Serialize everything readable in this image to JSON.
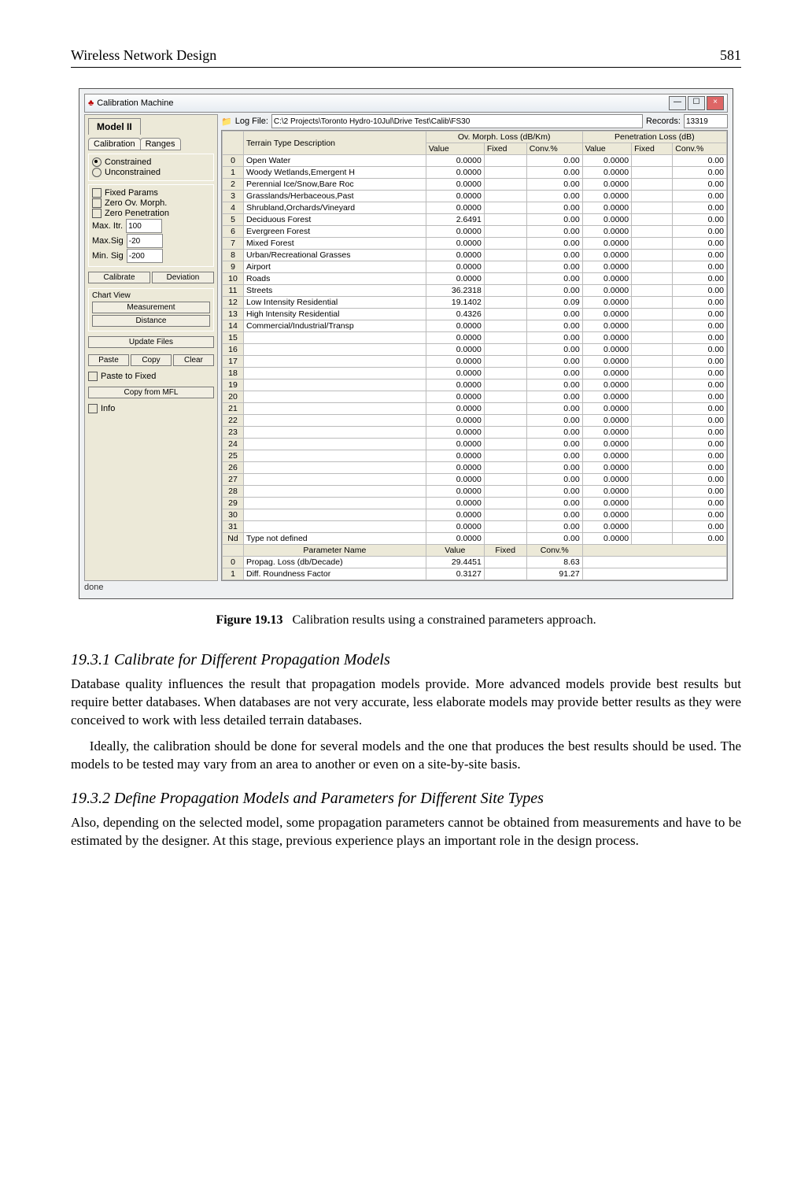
{
  "header": {
    "left": "Wireless Network Design",
    "right": "581"
  },
  "window": {
    "title": "Calibration Machine",
    "btn_min": "—",
    "btn_max": "☐",
    "btn_close": "×",
    "model_label": "Model II",
    "tabs": {
      "calibration": "Calibration",
      "ranges": "Ranges"
    },
    "radio_constrained": "Constrained",
    "radio_unconstrained": "Unconstrained",
    "chk_fixed_params": "Fixed Params",
    "chk_zero_ov": "Zero Ov. Morph.",
    "chk_zero_pen": "Zero Penetration",
    "lbl_max_itr": "Max. Itr.",
    "val_max_itr": "100",
    "lbl_max_sig": "Max.Sig",
    "val_max_sig": "-20",
    "lbl_min_sig": "Min. Sig",
    "val_min_sig": "-200",
    "btn_calibrate": "Calibrate",
    "btn_deviation": "Deviation",
    "chart_title": "Chart View",
    "btn_measurement": "Measurement",
    "btn_distance": "Distance",
    "btn_update": "Update Files",
    "btn_paste": "Paste",
    "btn_copy": "Copy",
    "btn_clear": "Clear",
    "chk_paste_fixed": "Paste to Fixed",
    "btn_copy_mfl": "Copy from MFL",
    "chk_info": "Info",
    "log_label": "Log File:",
    "log_path": "C:\\2 Projects\\Toronto Hydro-10Jul\\Drive Test\\Calib\\FS30",
    "records_label": "Records:",
    "records_val": "13319",
    "col_terrain": "Terrain Type Description",
    "grp_ov": "Ov. Morph. Loss (dB/Km)",
    "grp_pen": "Penetration Loss (dB)",
    "col_value": "Value",
    "col_fixed": "Fixed",
    "col_conv": "Conv.%",
    "param_header": "Parameter Name",
    "status": "done"
  },
  "terrain": [
    {
      "n": "0",
      "d": "Open Water",
      "ov": "0.0000",
      "oc": "0.00",
      "pv": "0.0000",
      "pc": "0.00"
    },
    {
      "n": "1",
      "d": "Woody Wetlands,Emergent H",
      "ov": "0.0000",
      "oc": "0.00",
      "pv": "0.0000",
      "pc": "0.00"
    },
    {
      "n": "2",
      "d": "Perennial Ice/Snow,Bare Roc",
      "ov": "0.0000",
      "oc": "0.00",
      "pv": "0.0000",
      "pc": "0.00"
    },
    {
      "n": "3",
      "d": "Grasslands/Herbaceous,Past",
      "ov": "0.0000",
      "oc": "0.00",
      "pv": "0.0000",
      "pc": "0.00"
    },
    {
      "n": "4",
      "d": "Shrubland,Orchards/Vineyard",
      "ov": "0.0000",
      "oc": "0.00",
      "pv": "0.0000",
      "pc": "0.00"
    },
    {
      "n": "5",
      "d": "Deciduous Forest",
      "ov": "2.6491",
      "oc": "0.00",
      "pv": "0.0000",
      "pc": "0.00"
    },
    {
      "n": "6",
      "d": "Evergreen Forest",
      "ov": "0.0000",
      "oc": "0.00",
      "pv": "0.0000",
      "pc": "0.00"
    },
    {
      "n": "7",
      "d": "Mixed Forest",
      "ov": "0.0000",
      "oc": "0.00",
      "pv": "0.0000",
      "pc": "0.00"
    },
    {
      "n": "8",
      "d": "Urban/Recreational Grasses",
      "ov": "0.0000",
      "oc": "0.00",
      "pv": "0.0000",
      "pc": "0.00"
    },
    {
      "n": "9",
      "d": "Airport",
      "ov": "0.0000",
      "oc": "0.00",
      "pv": "0.0000",
      "pc": "0.00"
    },
    {
      "n": "10",
      "d": "Roads",
      "ov": "0.0000",
      "oc": "0.00",
      "pv": "0.0000",
      "pc": "0.00"
    },
    {
      "n": "11",
      "d": "Streets",
      "ov": "36.2318",
      "oc": "0.00",
      "pv": "0.0000",
      "pc": "0.00"
    },
    {
      "n": "12",
      "d": "Low Intensity Residential",
      "ov": "19.1402",
      "oc": "0.09",
      "pv": "0.0000",
      "pc": "0.00"
    },
    {
      "n": "13",
      "d": "High Intensity Residential",
      "ov": "0.4326",
      "oc": "0.00",
      "pv": "0.0000",
      "pc": "0.00"
    },
    {
      "n": "14",
      "d": "Commercial/Industrial/Transp",
      "ov": "0.0000",
      "oc": "0.00",
      "pv": "0.0000",
      "pc": "0.00"
    },
    {
      "n": "15",
      "d": "",
      "ov": "0.0000",
      "oc": "0.00",
      "pv": "0.0000",
      "pc": "0.00"
    },
    {
      "n": "16",
      "d": "",
      "ov": "0.0000",
      "oc": "0.00",
      "pv": "0.0000",
      "pc": "0.00"
    },
    {
      "n": "17",
      "d": "",
      "ov": "0.0000",
      "oc": "0.00",
      "pv": "0.0000",
      "pc": "0.00"
    },
    {
      "n": "18",
      "d": "",
      "ov": "0.0000",
      "oc": "0.00",
      "pv": "0.0000",
      "pc": "0.00"
    },
    {
      "n": "19",
      "d": "",
      "ov": "0.0000",
      "oc": "0.00",
      "pv": "0.0000",
      "pc": "0.00"
    },
    {
      "n": "20",
      "d": "",
      "ov": "0.0000",
      "oc": "0.00",
      "pv": "0.0000",
      "pc": "0.00"
    },
    {
      "n": "21",
      "d": "",
      "ov": "0.0000",
      "oc": "0.00",
      "pv": "0.0000",
      "pc": "0.00"
    },
    {
      "n": "22",
      "d": "",
      "ov": "0.0000",
      "oc": "0.00",
      "pv": "0.0000",
      "pc": "0.00"
    },
    {
      "n": "23",
      "d": "",
      "ov": "0.0000",
      "oc": "0.00",
      "pv": "0.0000",
      "pc": "0.00"
    },
    {
      "n": "24",
      "d": "",
      "ov": "0.0000",
      "oc": "0.00",
      "pv": "0.0000",
      "pc": "0.00"
    },
    {
      "n": "25",
      "d": "",
      "ov": "0.0000",
      "oc": "0.00",
      "pv": "0.0000",
      "pc": "0.00"
    },
    {
      "n": "26",
      "d": "",
      "ov": "0.0000",
      "oc": "0.00",
      "pv": "0.0000",
      "pc": "0.00"
    },
    {
      "n": "27",
      "d": "",
      "ov": "0.0000",
      "oc": "0.00",
      "pv": "0.0000",
      "pc": "0.00"
    },
    {
      "n": "28",
      "d": "",
      "ov": "0.0000",
      "oc": "0.00",
      "pv": "0.0000",
      "pc": "0.00"
    },
    {
      "n": "29",
      "d": "",
      "ov": "0.0000",
      "oc": "0.00",
      "pv": "0.0000",
      "pc": "0.00"
    },
    {
      "n": "30",
      "d": "",
      "ov": "0.0000",
      "oc": "0.00",
      "pv": "0.0000",
      "pc": "0.00"
    },
    {
      "n": "31",
      "d": "",
      "ov": "0.0000",
      "oc": "0.00",
      "pv": "0.0000",
      "pc": "0.00"
    },
    {
      "n": "Nd",
      "d": "Type not defined",
      "ov": "0.0000",
      "oc": "0.00",
      "pv": "0.0000",
      "pc": "0.00"
    }
  ],
  "params": [
    {
      "n": "0",
      "d": "Propag. Loss (db/Decade)",
      "v": "29.4451",
      "c": "8.63"
    },
    {
      "n": "1",
      "d": "Diff. Roundness Factor",
      "v": "0.3127",
      "c": "91.27"
    }
  ],
  "caption": {
    "label": "Figure 19.13",
    "text": "Calibration results using a constrained parameters approach."
  },
  "sec1": {
    "head": "19.3.1   Calibrate for Different Propagation Models",
    "p1": "Database quality influences the result that propagation models provide. More advanced models provide best results but require better databases. When databases are not very accurate, less elaborate models may provide better results as they were conceived to work with less detailed terrain databases.",
    "p2": "Ideally, the calibration should be done for several models and the one that produces the best results should be used. The models to be tested may vary from an area to another or even on a site-by-site basis."
  },
  "sec2": {
    "head": "19.3.2   Define Propagation Models and Parameters for Different Site Types",
    "p1": "Also, depending on the selected model, some propagation parameters cannot be obtained from measurements and have to be estimated by the designer. At this stage, previous experience plays an important role in the design process."
  }
}
